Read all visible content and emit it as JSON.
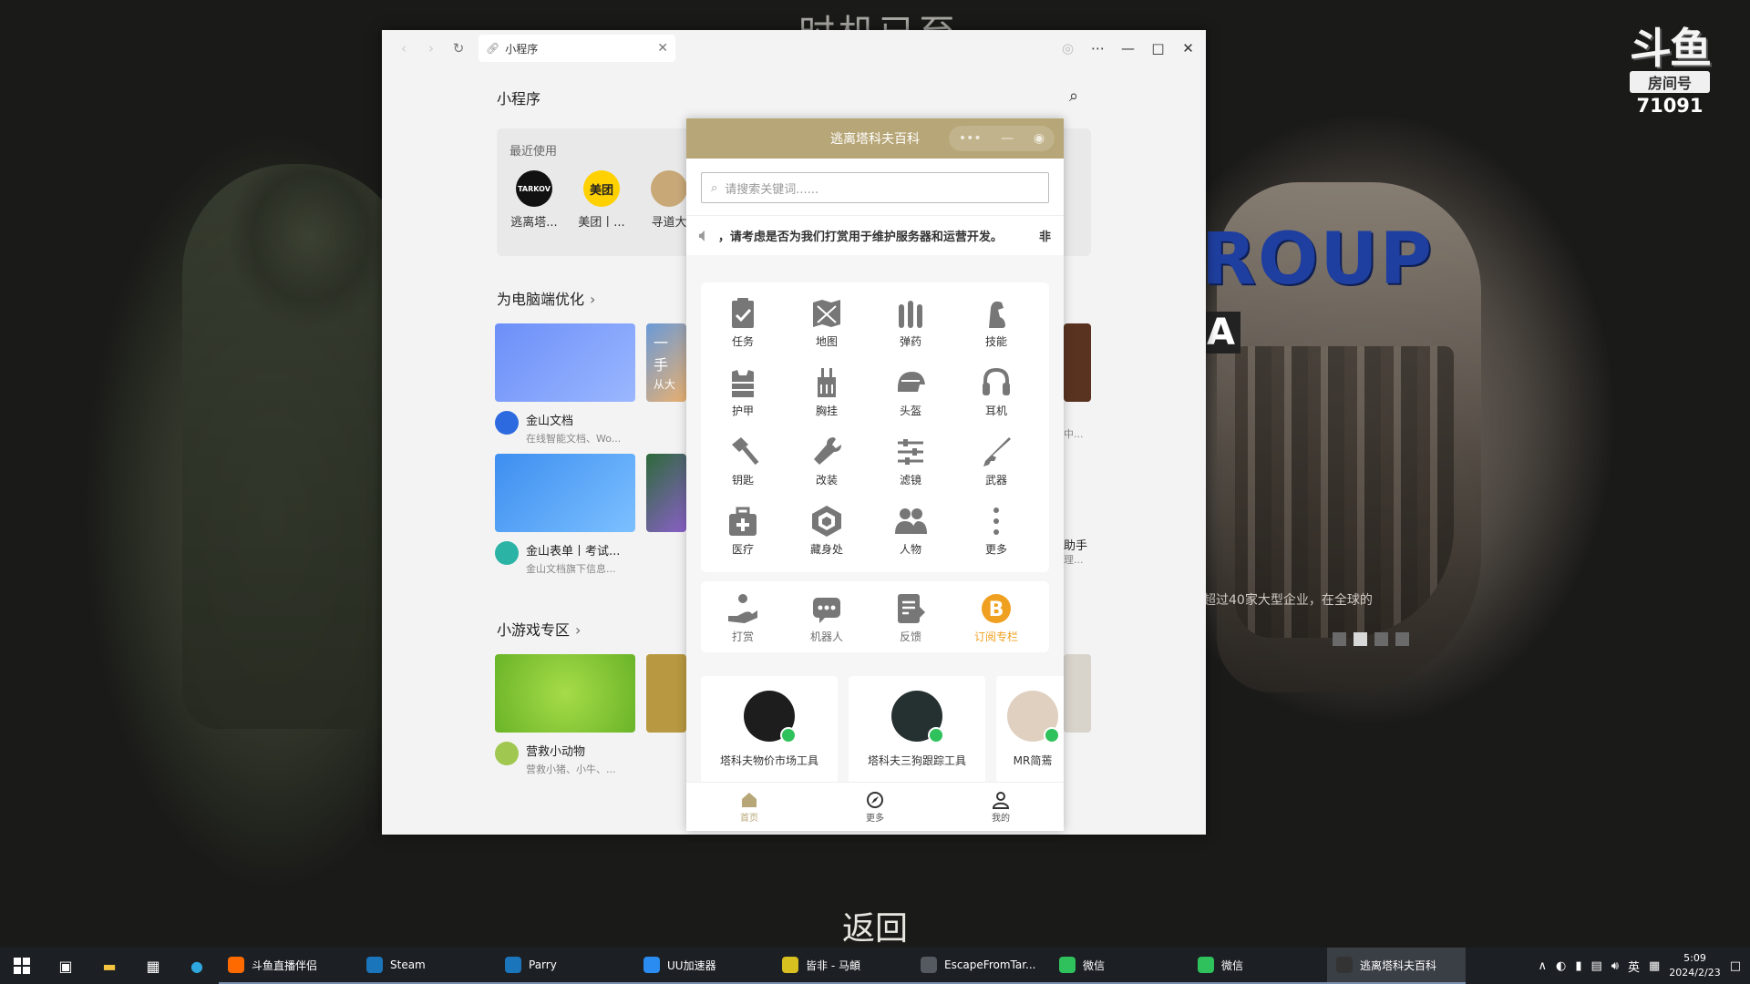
{
  "background": {
    "headline_top": "时机已至",
    "group_text": "ROUP",
    "a_text": "A",
    "promo_text": "超过40家大型企业，在全球的",
    "back_text": "返回",
    "room": {
      "logo": "斗鱼",
      "label": "房间号",
      "number": "71091"
    }
  },
  "browser": {
    "tab_title": "小程序",
    "page_title": "小程序",
    "recent": {
      "heading": "最近使用",
      "apps": [
        {
          "label": "逃离塔...",
          "icon_text": "TARKOV",
          "color": "#111111"
        },
        {
          "label": "美团丨...",
          "icon_text": "美团",
          "color": "#ffd100"
        },
        {
          "label": "寻道大",
          "icon_text": "",
          "color": "#c9a878"
        }
      ]
    },
    "section_pc": "为电脑端优化",
    "section_games": "小游戏专区",
    "cards": [
      {
        "title": "金山文档",
        "sub": "在线智能文档、Wo...",
        "color": "#5b8df5",
        "av": "#2d6ae0"
      },
      {
        "title": "金山表单丨考试...",
        "sub": "金山文档旗下信息...",
        "color": "#3d8ef0",
        "av": "#2bb3a5"
      },
      {
        "title": "营救小动物",
        "sub": "营救小猪、小牛、...",
        "color": "#8acb3c",
        "av": "#a0c850"
      },
      {
        "title": "一手",
        "sub": "从大",
        "color": "#6a9ad8",
        "av": "#e59a50"
      }
    ],
    "right_snippets": [
      "中...",
      "助手",
      "理..."
    ]
  },
  "mini": {
    "title": "逃离塔科夫百科",
    "search_placeholder": "请搜索关键词......",
    "notice": "，请考虑是否为我们打赏用于维护服务器和运营开发。",
    "notice_end": "非",
    "grid": [
      {
        "label": "任务",
        "icon": "clipboard-check-icon"
      },
      {
        "label": "地图",
        "icon": "map-icon"
      },
      {
        "label": "弹药",
        "icon": "ammo-icon"
      },
      {
        "label": "技能",
        "icon": "arm-icon"
      },
      {
        "label": "护甲",
        "icon": "armor-icon"
      },
      {
        "label": "胸挂",
        "icon": "rig-icon"
      },
      {
        "label": "头盔",
        "icon": "helmet-icon"
      },
      {
        "label": "耳机",
        "icon": "headset-icon"
      },
      {
        "label": "钥匙",
        "icon": "key-icon"
      },
      {
        "label": "改装",
        "icon": "wrench-icon"
      },
      {
        "label": "滤镜",
        "icon": "sliders-icon"
      },
      {
        "label": "武器",
        "icon": "rifle-icon"
      },
      {
        "label": "医疗",
        "icon": "medkit-icon"
      },
      {
        "label": "藏身处",
        "icon": "hideout-icon"
      },
      {
        "label": "人物",
        "icon": "people-icon"
      },
      {
        "label": "更多",
        "icon": "more-icon"
      }
    ],
    "actions": [
      {
        "label": "打赏",
        "icon": "donate-icon",
        "color": "#6d6d6d"
      },
      {
        "label": "机器人",
        "icon": "robot-icon",
        "color": "#6d6d6d"
      },
      {
        "label": "反馈",
        "icon": "feedback-icon",
        "color": "#6d6d6d"
      },
      {
        "label": "订阅专栏",
        "icon": "bitcoin-icon",
        "color": "#f0a020"
      }
    ],
    "bottom_cards": [
      "塔科夫物价市场工具",
      "塔科夫三狗跟踪工具",
      "MR简蔫"
    ],
    "tabbar": [
      "首页",
      "更多",
      "我的"
    ]
  },
  "taskbar": {
    "apps": [
      {
        "label": "斗鱼直播伴侣",
        "color": "#ff6a00"
      },
      {
        "label": "Steam",
        "color": "#1b75bb"
      },
      {
        "label": "Parry",
        "color": "#1b75bb"
      },
      {
        "label": "UU加速器",
        "color": "#2a8cf0"
      },
      {
        "label": "皆非 - 马頔",
        "color": "#d8c020"
      },
      {
        "label": "EscapeFromTar...",
        "color": "#555a60"
      },
      {
        "label": "微信",
        "color": "#2fc15b"
      },
      {
        "label": "微信",
        "color": "#2fc15b"
      },
      {
        "label": "逃离塔科夫百科",
        "color": "#333333"
      }
    ],
    "ime": "英",
    "time": "5:09",
    "date": "2024/2/23"
  }
}
